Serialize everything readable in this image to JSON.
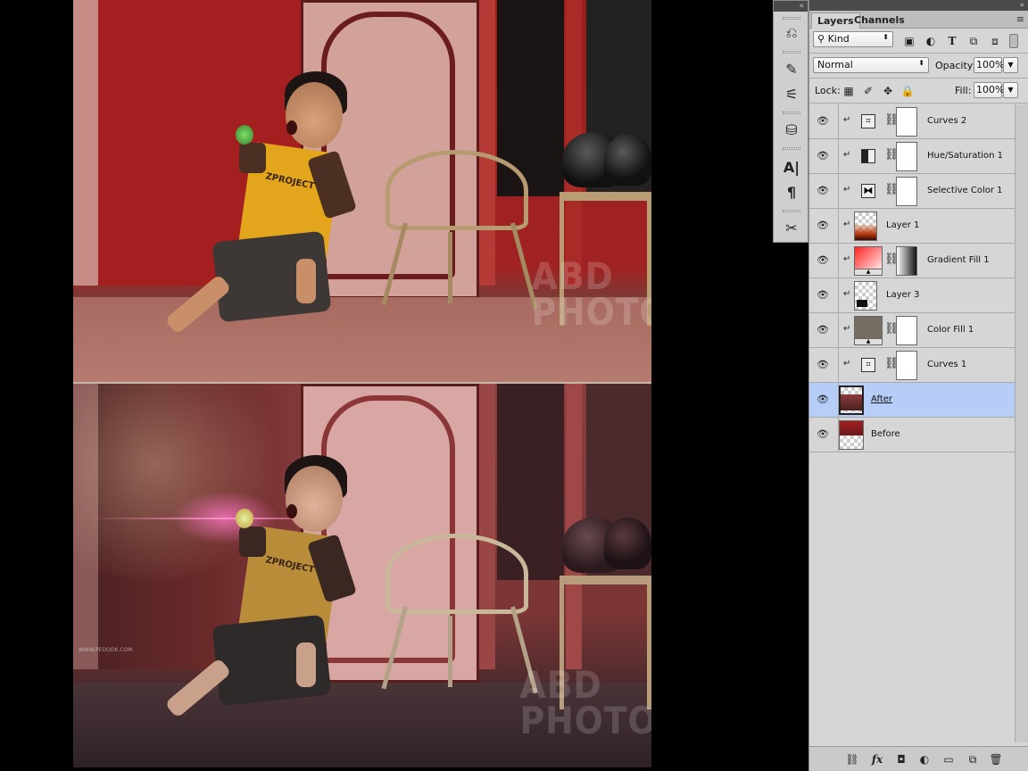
{
  "canvas": {
    "watermark_before": [
      "ABD",
      "PHOTO"
    ],
    "watermark_after": [
      "ABD",
      "PHOTO"
    ],
    "after_small_watermark": "WWW.PEDOOK.COM",
    "shirt_text": "ZPROJECT",
    "shirt_text_after": "ZPROJECT"
  },
  "toolstrip": {
    "collapse_icon": "«",
    "tools": [
      "history-icon",
      "brush-presets-icon",
      "adjust-brush-icon",
      "clone-source-icon",
      "character-icon",
      "paragraph-icon",
      "tool-presets-icon"
    ]
  },
  "panel": {
    "collapse_icon": "»",
    "tabs": [
      "Layers",
      "Channels"
    ],
    "menu_icon": "≡",
    "filter_kind": "Kind",
    "filter_icons": [
      "image-filter-icon",
      "adjustment-filter-icon",
      "type-filter-icon",
      "shape-filter-icon",
      "smart-object-filter-icon",
      "filter-toggle-icon"
    ],
    "blend_mode": "Normal",
    "opacity_label": "Opacity:",
    "opacity_value": "100%",
    "lock_label": "Lock:",
    "fill_label": "Fill:",
    "fill_value": "100%"
  },
  "layers": [
    {
      "name": "Curves 2",
      "type": "adjustment",
      "icon": "curves-icon",
      "clipped": true,
      "selected": false
    },
    {
      "name": "Hue/Saturation 1",
      "type": "adjustment",
      "icon": "hue-saturation-icon",
      "clipped": true,
      "selected": false
    },
    {
      "name": "Selective Color 1",
      "type": "adjustment",
      "icon": "selective-color-icon",
      "clipped": true,
      "selected": false
    },
    {
      "name": "Layer 1",
      "type": "pixel",
      "clipped": true,
      "selected": false
    },
    {
      "name": "Gradient Fill 1",
      "type": "fill",
      "clipped": true,
      "selected": false
    },
    {
      "name": "Layer 3",
      "type": "pixel",
      "clipped": true,
      "selected": false
    },
    {
      "name": "Color Fill 1",
      "type": "fill",
      "clipped": true,
      "selected": false
    },
    {
      "name": "Curves 1",
      "type": "adjustment",
      "icon": "curves-icon",
      "clipped": true,
      "selected": false
    },
    {
      "name": "After",
      "type": "pixel",
      "clipped": false,
      "selected": true
    },
    {
      "name": "Before",
      "type": "pixel",
      "clipped": false,
      "selected": false
    }
  ],
  "bottom_bar": [
    "link-layers-icon",
    "fx-icon",
    "add-mask-icon",
    "new-adjustment-icon",
    "new-group-icon",
    "new-layer-icon",
    "delete-layer-icon"
  ],
  "colors": {
    "selected_layer": "#b6cdf7",
    "panel_bg": "#d6d6d6",
    "wall_red": "#a02222"
  }
}
